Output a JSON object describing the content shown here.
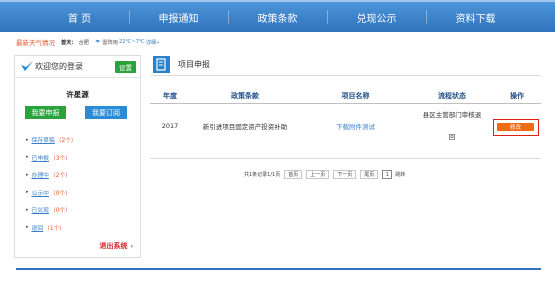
{
  "nav": {
    "items": [
      "首 页",
      "申报通知",
      "政策条款",
      "兑现公示",
      "资料下载"
    ]
  },
  "weather": {
    "alert": "最新天气情况",
    "label": "首天：",
    "city": "合肥",
    "desc": "雷阵雨",
    "temp": "22℃~7℃",
    "detail": "详细»"
  },
  "sidebar": {
    "title": "欢迎您的登录",
    "settings_label": "设置",
    "username": "许星源",
    "btn_declare": "我要申报",
    "btn_subscribe": "我要订阅",
    "links": [
      {
        "label": "保存草稿",
        "count": "（2个）"
      },
      {
        "label": "已申报",
        "count": "（3个）"
      },
      {
        "label": "办理中",
        "count": "（2个）"
      },
      {
        "label": "公示中",
        "count": "（0个）"
      },
      {
        "label": "已兑现",
        "count": "（0个）"
      },
      {
        "label": "退回",
        "count": "（1个）"
      }
    ],
    "logout": "退出系统"
  },
  "main": {
    "title": "项目申报",
    "table": {
      "headers": [
        "年度",
        "政策条款",
        "项目名称",
        "流程状态",
        "操作"
      ],
      "rows": [
        {
          "year": "2017",
          "policy": "新引进项目固定资产投资补助",
          "project": "下载附件测试",
          "status_line1": "县区主管部门审核退",
          "status_line2": "回",
          "action": "修改"
        }
      ]
    },
    "pager": {
      "info": "共1条记录1/1页",
      "first": "首页",
      "prev": "上一页",
      "next": "下一页",
      "last": "尾页",
      "page_value": "1",
      "go": "跳转"
    }
  },
  "colors": {
    "nav_bg": "#2f74bd",
    "green": "#2ba23c",
    "blue": "#2a8bd8",
    "orange": "#ee6b17",
    "red": "#d6262b"
  }
}
